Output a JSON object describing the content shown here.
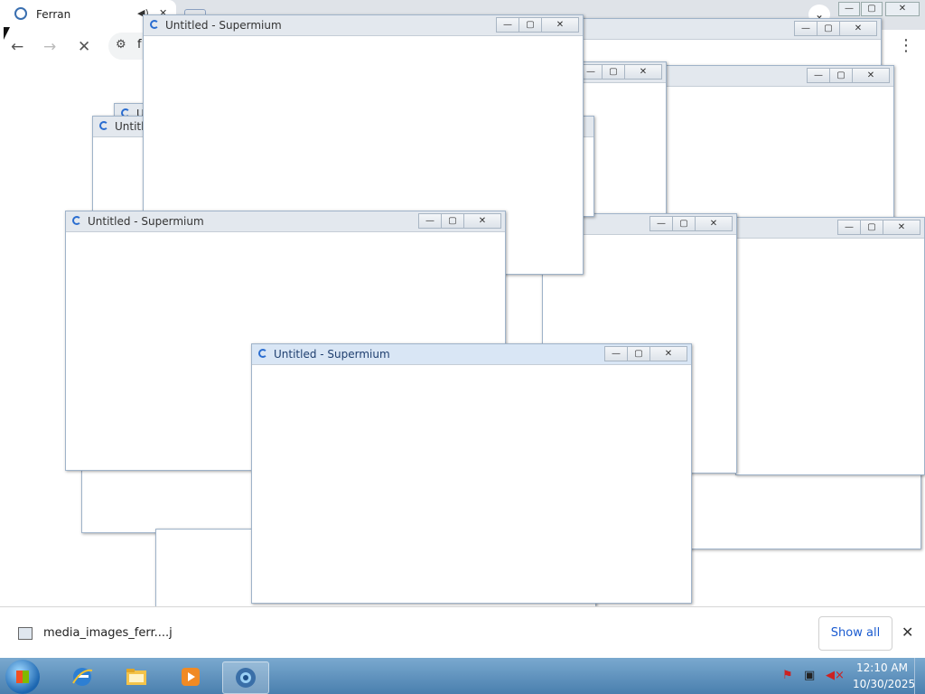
{
  "browser": {
    "tab_title": "Ferran",
    "omnibox_text": "f",
    "download_file": "media_images_ferr....j",
    "show_all": "Show all",
    "close_shelf": "✕",
    "menu": "⋮",
    "back": "←",
    "forward": "→",
    "stop": "✕",
    "tabsearch": "⌄",
    "tab_close": "✕",
    "tab_audio": "◀)"
  },
  "window_title": "Untitled - Supermium",
  "window_title_short": "Untitled",
  "window_title_clip": "U",
  "win_controls": {
    "minimize": "—",
    "maximize": "▢",
    "close": "✕"
  },
  "taskbar": {
    "time": "12:10 AM",
    "date": "10/30/2025",
    "apps": [
      "internet-explorer",
      "file-explorer",
      "media-player",
      "supermium"
    ]
  },
  "colors": {
    "accent": "#2a6dd0",
    "taskbar": "#5b8fbe"
  }
}
